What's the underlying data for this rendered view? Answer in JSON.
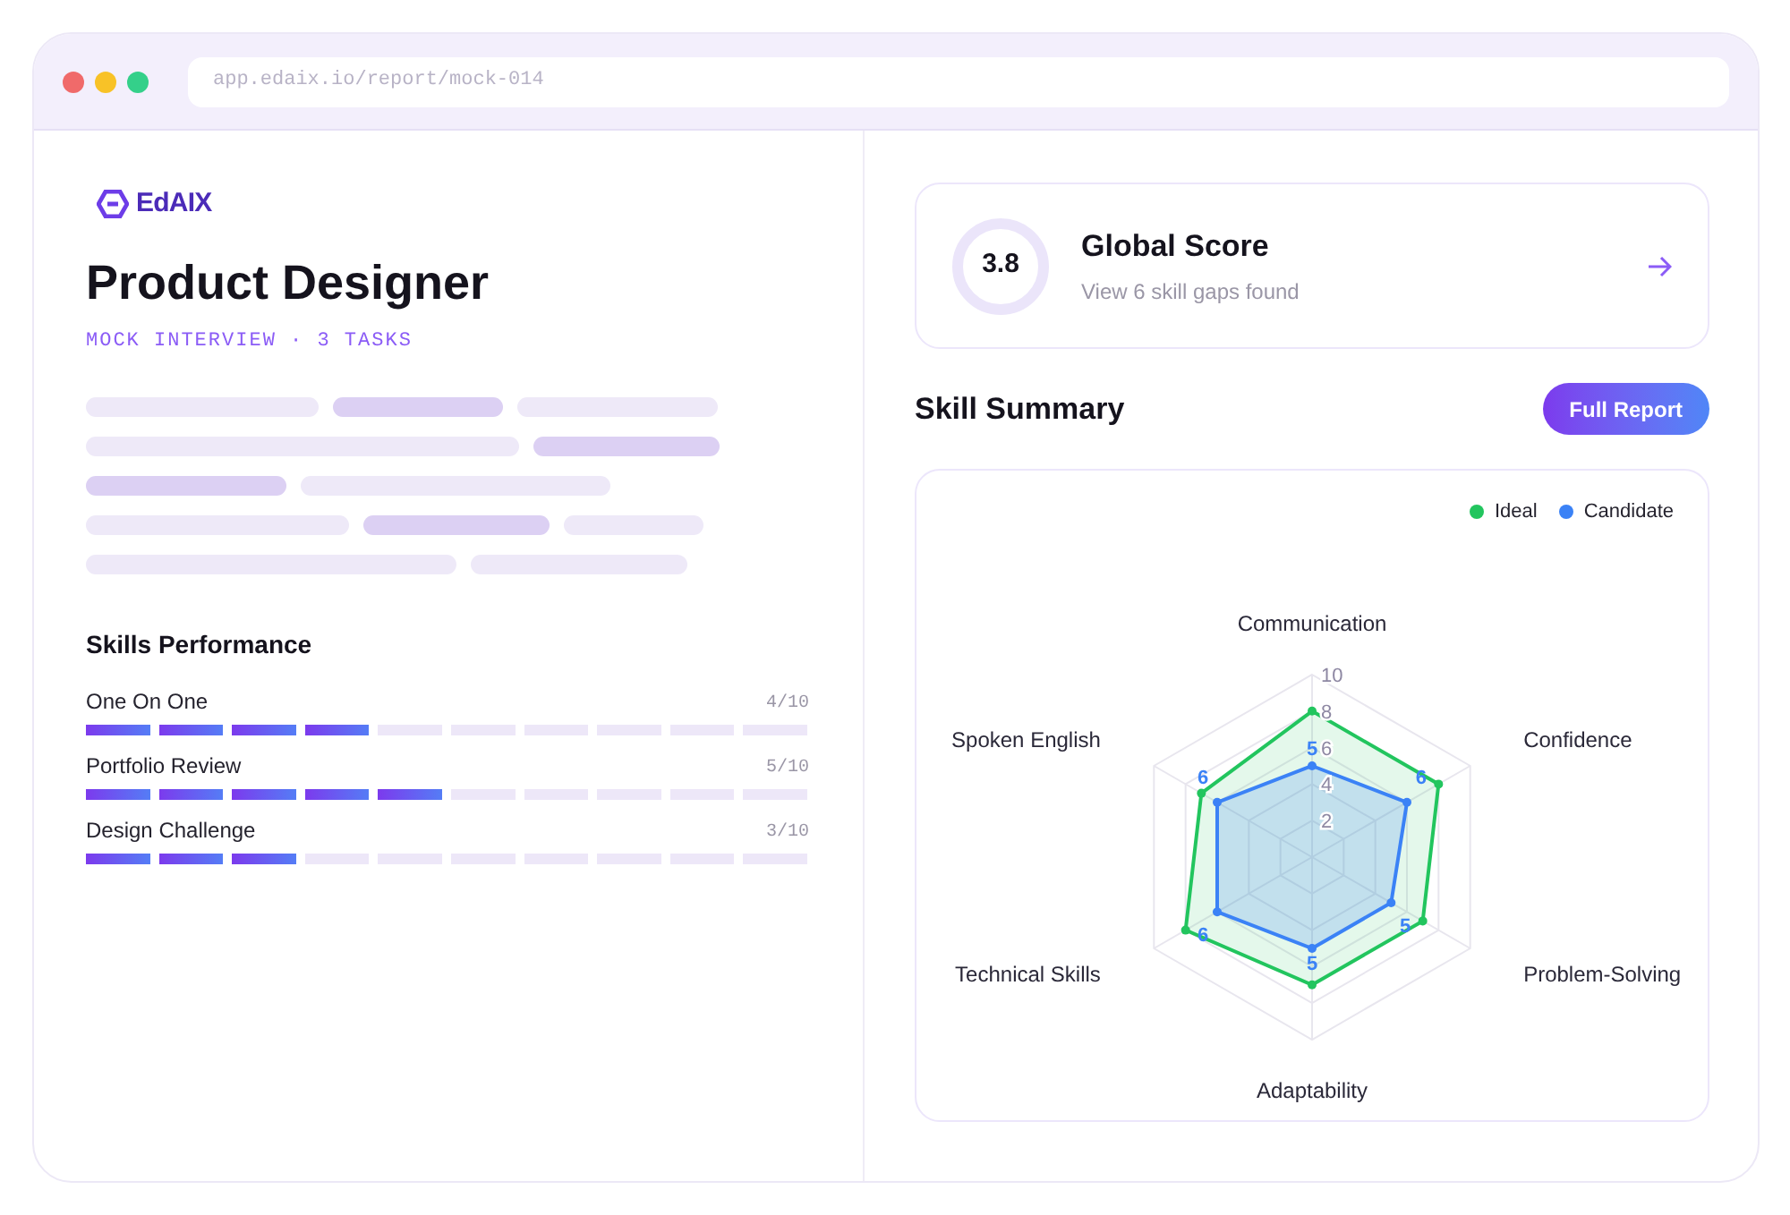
{
  "browser": {
    "url": "app.edaix.io/report/mock-014"
  },
  "brand": {
    "name": "EdAIX"
  },
  "title": "Product Designer",
  "subtitle": "MOCK INTERVIEW · 3 TASKS",
  "skills_performance": {
    "title": "Skills Performance",
    "items": [
      {
        "name": "One On One",
        "score": "4/10",
        "level": 0.4
      },
      {
        "name": "Portfolio Review",
        "score": "5/10",
        "level": 0.5
      },
      {
        "name": "Design Challenge",
        "score": "3/10",
        "level": 0.3
      }
    ]
  },
  "global_score": {
    "value": "3.8",
    "title": "Global Score",
    "subtitle": "View 6 skill gaps found"
  },
  "skill_summary": {
    "title": "Skill Summary",
    "button": "Full Report",
    "chart_data": {
      "type": "radar",
      "categories": [
        "Communication",
        "Confidence",
        "Problem-Solving",
        "Adaptability",
        "Technical Skills",
        "Spoken English"
      ],
      "ylim": [
        0,
        10
      ],
      "yticks": [
        2,
        4,
        6,
        8,
        10
      ],
      "series": [
        {
          "name": "Ideal",
          "color": "#22c55e",
          "values": [
            8,
            8,
            7,
            7,
            8,
            7
          ]
        },
        {
          "name": "Candidate",
          "color": "#3b82f6",
          "values": [
            5,
            6,
            5,
            5,
            6,
            6
          ],
          "data_labels": true
        }
      ]
    }
  }
}
